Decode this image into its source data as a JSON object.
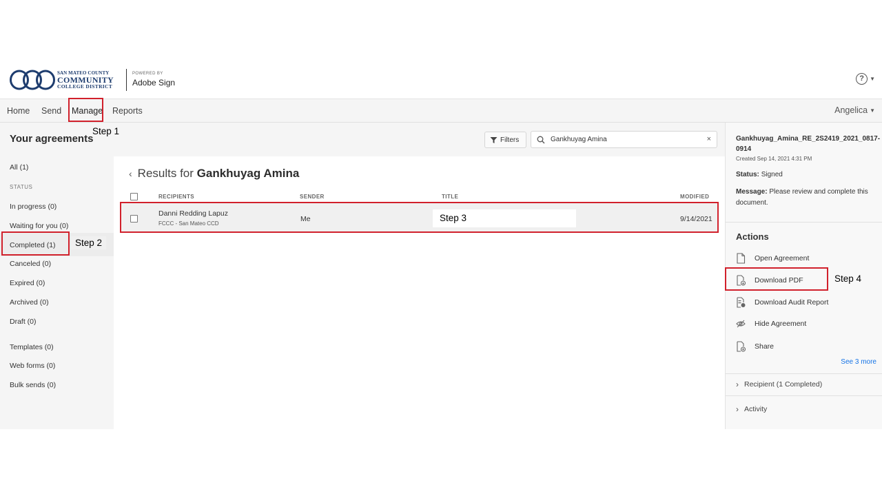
{
  "logo": {
    "line1": "SAN MATEO COUNTY",
    "line2": "COMMUNITY",
    "line3": "COLLEGE DISTRICT",
    "powered_by": "POWERED BY",
    "product": "Adobe Sign"
  },
  "header": {
    "help_glyph": "?"
  },
  "nav": {
    "items": [
      "Home",
      "Send",
      "Manage",
      "Reports"
    ],
    "user": "Angelica"
  },
  "sidebar": {
    "title": "Your agreements",
    "all": "All (1)",
    "status_label": "STATUS",
    "statuses": [
      "In progress (0)",
      "Waiting for you (0)",
      "Completed (1)",
      "Canceled (0)",
      "Expired (0)",
      "Archived (0)",
      "Draft (0)"
    ],
    "extras": [
      "Templates (0)",
      "Web forms (0)",
      "Bulk sends (0)"
    ]
  },
  "toolbar": {
    "filters_label": "Filters",
    "search_value": "Gankhuyag Amina",
    "clear_glyph": "×"
  },
  "results": {
    "prefix": "Results for",
    "query": "Gankhuyag Amina",
    "columns": [
      "RECIPIENTS",
      "SENDER",
      "TITLE",
      "MODIFIED"
    ],
    "rows": [
      {
        "recipient": "Danni Redding Lapuz",
        "recipient_org": "FCCC - San Mateo CCD",
        "sender": "Me",
        "title": "Step 3",
        "modified": "9/14/2021"
      }
    ]
  },
  "details": {
    "title": "Gankhuyag_Amina_RE_2S2419_2021_0817-0914",
    "created": "Created Sep 14, 2021 4:31 PM",
    "status_label": "Status:",
    "status_value": "Signed",
    "message_label": "Message:",
    "message_value": "Please review and complete this document.",
    "actions_title": "Actions",
    "actions": [
      "Open Agreement",
      "Download PDF",
      "Download Audit Report",
      "Hide Agreement",
      "Share"
    ],
    "see_more": "See 3 more",
    "recipient_section": "Recipient (1 Completed)",
    "activity_section": "Activity"
  },
  "annotations": {
    "step1": "Step 1",
    "step2": "Step 2",
    "step4": "Step 4",
    "highlight_color": "#d1202b"
  }
}
